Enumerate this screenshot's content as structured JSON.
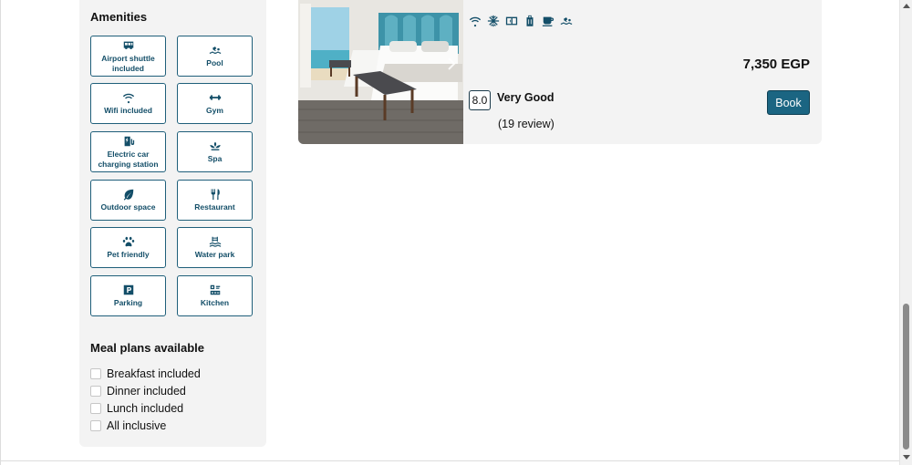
{
  "amenities": {
    "title": "Amenities",
    "items": [
      {
        "label": "Airport shuttle included",
        "icon": "shuttle-icon"
      },
      {
        "label": "Pool",
        "icon": "pool-icon"
      },
      {
        "label": "Wifi included",
        "icon": "wifi-icon"
      },
      {
        "label": "Gym",
        "icon": "dumbbell-icon"
      },
      {
        "label": "Electric car charging station",
        "icon": "ev-charger-icon"
      },
      {
        "label": "Spa",
        "icon": "spa-icon"
      },
      {
        "label": "Outdoor space",
        "icon": "leaf-icon"
      },
      {
        "label": "Restaurant",
        "icon": "utensils-icon"
      },
      {
        "label": "Pet friendly",
        "icon": "paw-icon"
      },
      {
        "label": "Water park",
        "icon": "water-park-icon"
      },
      {
        "label": "Parking",
        "icon": "parking-icon"
      },
      {
        "label": "Kitchen",
        "icon": "kitchen-icon"
      }
    ]
  },
  "meal_plans": {
    "title": "Meal plans available",
    "items": [
      {
        "label": "Breakfast included",
        "checked": false
      },
      {
        "label": "Dinner included",
        "checked": false
      },
      {
        "label": "Lunch included",
        "checked": false
      },
      {
        "label": "All inclusive",
        "checked": false
      }
    ]
  },
  "hotel_card": {
    "amenity_icons": [
      "wifi-icon",
      "snowflake-icon",
      "fridge-icon",
      "luggage-icon",
      "coffee-icon",
      "pool-icon"
    ],
    "price": "7,350 EGP",
    "book_label": "Book",
    "score": "8.0",
    "rating_word": "Very Good",
    "reviews": "(19 review)"
  },
  "colors": {
    "accent": "#1b6582",
    "accent_dark": "#134e68",
    "panel_bg": "#f3f3f3"
  }
}
